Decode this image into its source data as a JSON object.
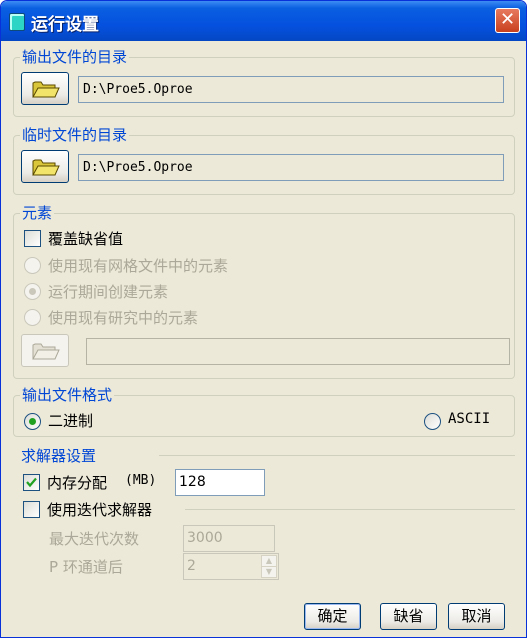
{
  "window": {
    "title": "运行设置",
    "close_glyph": "✕",
    "icon": "app-icon"
  },
  "output_dir": {
    "legend": "输出文件的目录",
    "path": "D:\\Proe5.Oproe",
    "button_icon": "folder-open-icon"
  },
  "temp_dir": {
    "legend": "临时文件的目录",
    "path": "D:\\Proe5.Oproe",
    "button_icon": "folder-open-icon"
  },
  "elements": {
    "legend": "元素",
    "override_label": "覆盖缺省值",
    "override_checked": false,
    "options": [
      {
        "label": "使用现有网格文件中的元素",
        "selected": false,
        "enabled": false
      },
      {
        "label": "运行期间创建元素",
        "selected": true,
        "enabled": false
      },
      {
        "label": "使用现有研究中的元素",
        "selected": false,
        "enabled": false
      }
    ],
    "path": ""
  },
  "output_format": {
    "legend": "输出文件格式",
    "options": [
      {
        "label": "二进制",
        "selected": true
      },
      {
        "label": "ASCII",
        "selected": false
      }
    ]
  },
  "solver": {
    "legend": "求解器设置",
    "memory_label": "内存分配",
    "memory_unit": "(MB)",
    "memory_checked": true,
    "memory_value": "128",
    "iterative_label": "使用迭代求解器",
    "iterative_checked": false,
    "max_iter_label": "最大迭代次数",
    "max_iter_value": "3000",
    "p_loop_label": "P 环通道后",
    "p_loop_value": "2"
  },
  "footer": {
    "ok_label": "确定",
    "default_label": "缺省",
    "cancel_label": "取消"
  },
  "colors": {
    "title_bar": "#0551df",
    "legend_text": "#0046d5",
    "dialog_bg": "#ece9d8",
    "check_green": "#21a121"
  }
}
